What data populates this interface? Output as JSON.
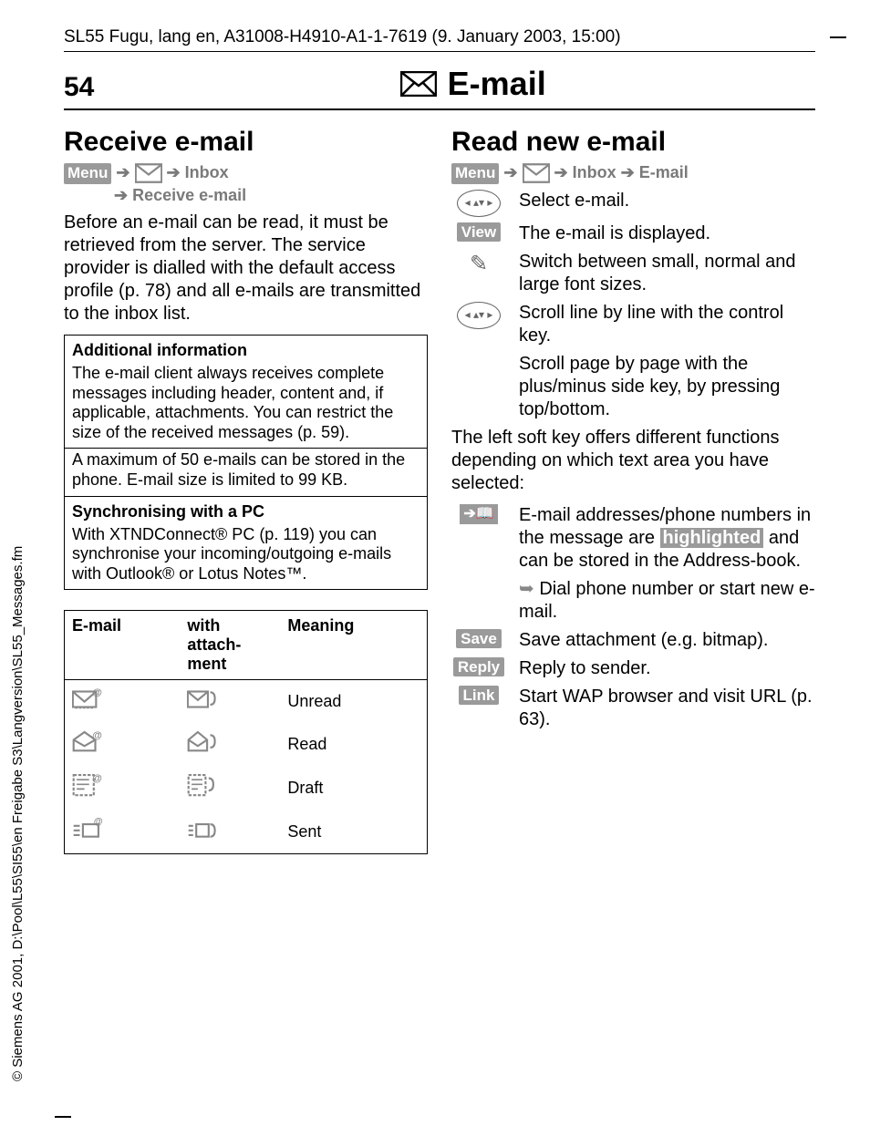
{
  "header": {
    "path_text": "SL55 Fugu, lang en, A31008-H4910-A1-1-7619 (9. January 2003, 15:00)"
  },
  "page": {
    "number": "54",
    "title": "E-mail"
  },
  "left": {
    "heading": "Receive e-mail",
    "menu_label": "Menu",
    "path1": "Inbox",
    "path2": "Receive e-mail",
    "body": "Before an e-mail can be read, it must be retrieved from the server. The service provider is dialled with the default access profile (p. 78) and all e-mails are transmitted to the inbox list.",
    "info": {
      "title": "Additional information",
      "p1": "The e-mail client always receives complete messages including header, content and, if applicable, attachments. You can restrict the size of the received messages (p. 59).",
      "p2": "A maximum of 50 e-mails can be stored in the phone. E-mail size is limited to 99 KB.",
      "sync_title": "Synchronising with a PC",
      "sync_body": "With XTNDConnect® PC (p. 119) you can synchronise your incoming/outgoing e-mails with Outlook® or Lotus Notes™."
    },
    "table": {
      "h1": "E-mail",
      "h2": "with attach-ment",
      "h3": "Meaning",
      "rows": [
        "Unread",
        "Read",
        "Draft",
        "Sent"
      ]
    }
  },
  "right": {
    "heading": "Read new e-mail",
    "menu_label": "Menu",
    "path1": "Inbox",
    "path2": "E-mail",
    "items": {
      "select": "Select e-mail.",
      "view_label": "View",
      "view_desc": "The e-mail is displayed.",
      "font_desc": "Switch between small, normal and large font sizes.",
      "scroll_line": "Scroll line by line with the control key.",
      "scroll_page": "Scroll page by page with the plus/minus side key, by pressing top/bottom."
    },
    "softkey_intro": "The left soft key offers different functions depending on which text area you have selected:",
    "addr_desc_pre": "E-mail addresses/phone numbers in the message are ",
    "addr_highlight": "highlighted",
    "addr_desc_post": " and can be stored in the Address-book.",
    "dial_desc": "Dial phone number or start new e-mail.",
    "save_label": "Save",
    "save_desc": "Save attachment (e.g. bitmap).",
    "reply_label": "Reply",
    "reply_desc": "Reply to sender.",
    "link_label": "Link",
    "link_desc": "Start WAP browser and visit URL (p. 63)."
  },
  "copyright": "© Siemens AG 2001, D:\\Pool\\L55\\SI55\\en Freigabe S3\\Langversion\\SL55_Messages.fm"
}
